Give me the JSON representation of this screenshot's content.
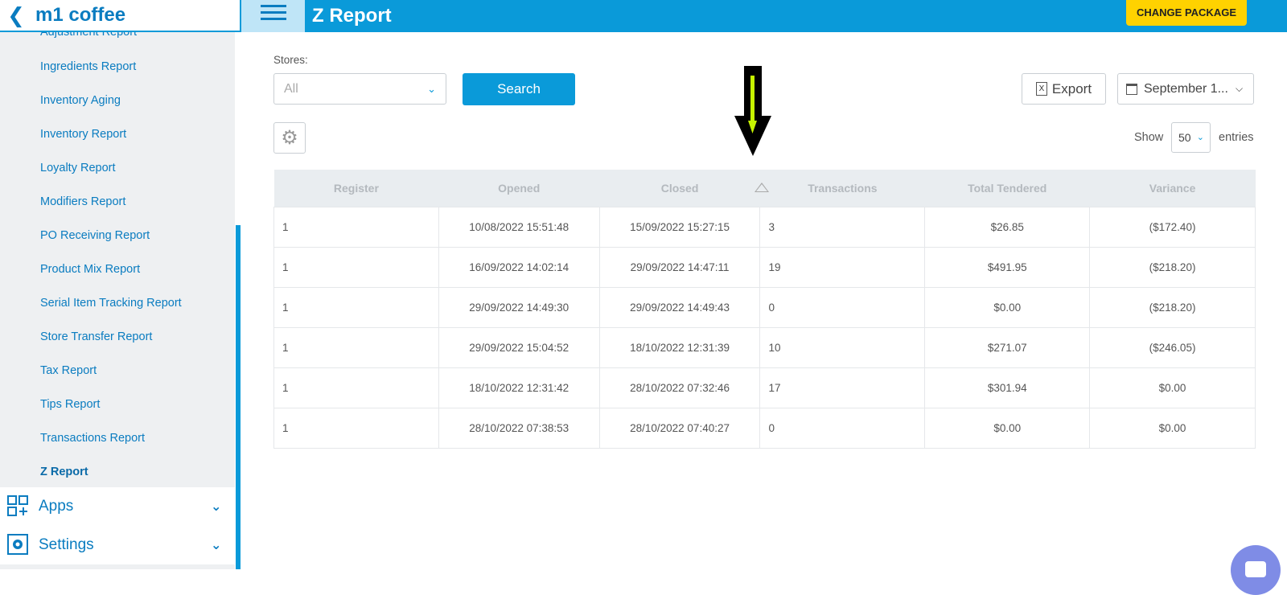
{
  "brand": {
    "back_icon": "chevron-left-icon",
    "name": "m1 coffee"
  },
  "sidebar": {
    "partial_item": "Adjustment Report",
    "items": [
      "Ingredients Report",
      "Inventory Aging",
      "Inventory Report",
      "Loyalty Report",
      "Modifiers Report",
      "PO Receiving Report",
      "Product Mix Report",
      "Serial Item Tracking Report",
      "Store Transfer Report",
      "Tax Report",
      "Tips Report",
      "Transactions Report",
      "Z Report"
    ],
    "active_item": "Z Report",
    "groups": [
      {
        "label": "Apps",
        "icon": "apps-grid-icon"
      },
      {
        "label": "Settings",
        "icon": "settings-gear-icon"
      }
    ]
  },
  "header": {
    "menu_icon": "hamburger-icon",
    "title": "Z Report",
    "change_package_label": "CHANGE PACKAGE"
  },
  "filters": {
    "stores_label": "Stores:",
    "stores_value": "All",
    "search_label": "Search",
    "export_label": "Export",
    "date_range": "September 1...",
    "show_label": "Show",
    "page_length": "50",
    "entries_label": "entries"
  },
  "table": {
    "columns": [
      "Register",
      "Opened",
      "Closed",
      "Transactions",
      "Total Tendered",
      "Variance"
    ],
    "sorted_column": "Closed",
    "rows": [
      [
        "1",
        "10/08/2022 15:51:48",
        "15/09/2022 15:27:15",
        "3",
        "$26.85",
        "($172.40)"
      ],
      [
        "1",
        "16/09/2022 14:02:14",
        "29/09/2022 14:47:11",
        "19",
        "$491.95",
        "($218.20)"
      ],
      [
        "1",
        "29/09/2022 14:49:30",
        "29/09/2022 14:49:43",
        "0",
        "$0.00",
        "($218.20)"
      ],
      [
        "1",
        "29/09/2022 15:04:52",
        "18/10/2022 12:31:39",
        "10",
        "$271.07",
        "($246.05)"
      ],
      [
        "1",
        "18/10/2022 12:31:42",
        "28/10/2022 07:32:46",
        "17",
        "$301.94",
        "$0.00"
      ],
      [
        "1",
        "28/10/2022 07:38:53",
        "28/10/2022 07:40:27",
        "0",
        "$0.00",
        "$0.00"
      ]
    ]
  },
  "colors": {
    "primary": "#0a9ad9",
    "accent_button": "#ffd200",
    "annotation_arrow": "#000000",
    "annotation_arrow_inner": "#c6f400"
  }
}
